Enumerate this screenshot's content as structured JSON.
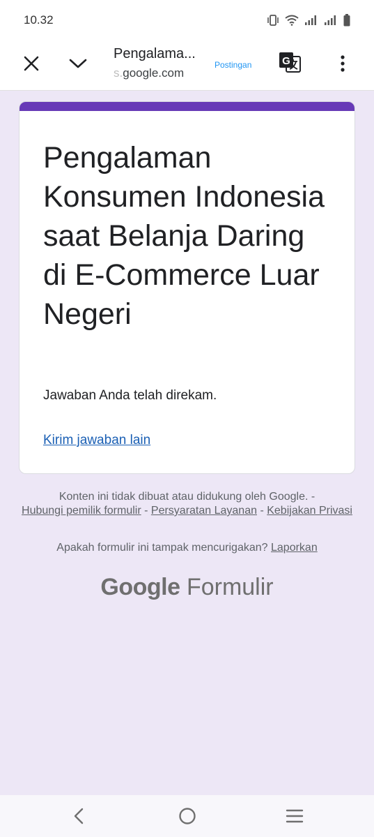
{
  "status_bar": {
    "time": "10.32",
    "icons": [
      "vibrate-icon",
      "wifi-icon",
      "signal-icon",
      "signal-icon",
      "battery-icon"
    ]
  },
  "app_bar": {
    "title": "Pengalama...",
    "url_prefix": "s.",
    "url_main": "google.com",
    "badge": "Postingan",
    "icons": [
      "close-icon",
      "chevron-down-icon",
      "translate-icon",
      "more-vert-icon"
    ]
  },
  "card": {
    "accent_color": "#673ab7",
    "title": "Pengalaman Konsumen Indonesia saat Belanja Daring di E-Commerce Luar Negeri",
    "confirmation": "Jawaban Anda telah direkam.",
    "submit_another": "Kirim jawaban lain"
  },
  "footer": {
    "disclaimer": "Konten ini tidak dibuat atau didukung oleh Google. -",
    "contact_owner": "Hubungi pemilik formulir",
    "sep": "-",
    "terms": "Persyaratan Layanan",
    "privacy": "Kebijakan Privasi",
    "suspicious_text": "Apakah formulir ini tampak mencurigakan?",
    "report": "Laporkan",
    "brand_google": "Google",
    "brand_forms": "Formulir"
  },
  "nav_bar": {
    "icons": [
      "back-icon",
      "home-icon",
      "recents-icon"
    ]
  }
}
